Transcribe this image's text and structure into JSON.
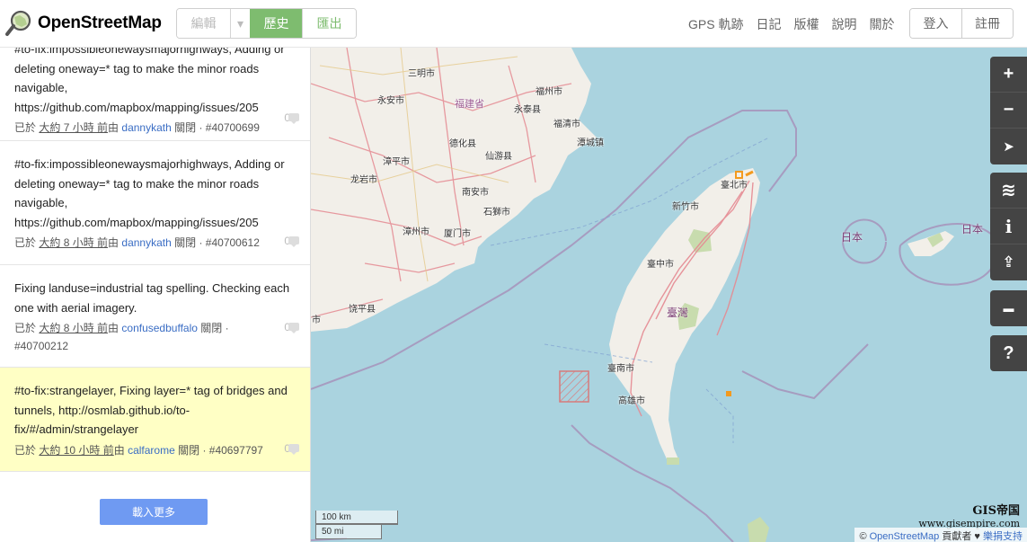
{
  "header": {
    "app_name": "OpenStreetMap",
    "edit_label": "編輯",
    "edit_caret": "▾",
    "history_label": "歷史",
    "export_label": "匯出",
    "nav": [
      "GPS 軌跡",
      "日記",
      "版權",
      "說明",
      "關於"
    ],
    "login_label": "登入",
    "signup_label": "註冊"
  },
  "sidebar": {
    "changesets": [
      {
        "comment": "#to-fix:impossibleonewaysmajorhighways, Adding or deleting oneway=* tag to make the minor roads navigable, https://github.com/mapbox/mapping/issues/205",
        "prefix": "已於",
        "time": "大約 7 小時 前",
        "by": "由",
        "user": "dannykath",
        "status": "關閉 · #40700699",
        "comments": "0"
      },
      {
        "comment": "#to-fix:impossibleonewaysmajorhighways, Adding or deleting oneway=* tag to make the minor roads navigable, https://github.com/mapbox/mapping/issues/205",
        "prefix": "已於",
        "time": "大約 8 小時 前",
        "by": "由",
        "user": "dannykath",
        "status": "關閉 · #40700612",
        "comments": "0"
      },
      {
        "comment": "Fixing landuse=industrial tag spelling. Checking each one with aerial imagery.",
        "prefix": "已於",
        "time": "大約 8 小時 前",
        "by": "由",
        "user": "confusedbuffalo",
        "status": "關閉 · #40700212",
        "comments": "0"
      },
      {
        "comment": "#to-fix:strangelayer, Fixing layer=* tag of bridges and tunnels, http://osmlab.github.io/to-fix/#/admin/strangelayer",
        "prefix": "已於",
        "time": "大約 10 小時 前",
        "by": "由",
        "user": "calfarome",
        "status": "關閉 · #40697797",
        "comments": "0"
      }
    ],
    "load_more_label": "載入更多"
  },
  "map": {
    "labels": {
      "sanming": "三明市",
      "fujian": "福建省",
      "fuzhou": "福州市",
      "yongan": "永安市",
      "yongtai": "永泰县",
      "fuqing": "福清市",
      "dehua": "德化县",
      "tantou": "潭城镇",
      "zhangping": "漳平市",
      "xianyou": "仙游县",
      "longyan": "龙岩市",
      "nanan": "南安市",
      "shishi": "石獅市",
      "zhangzhou": "漳州市",
      "xiamen": "厦门市",
      "raoping": "饶平县",
      "shi_edge": "市",
      "taipei": "臺北市",
      "xinzhu": "新竹市",
      "taizhong": "臺中市",
      "taiwan": "臺灣",
      "tainan": "臺南市",
      "gaoxiong": "高雄市",
      "japan1": "日本",
      "japan2": "日本"
    },
    "controls": {
      "zoom_in": "+",
      "zoom_out": "−",
      "locate": "➤",
      "layers": "≋",
      "info": "i",
      "share": "⇪",
      "note": "▬",
      "help": "?"
    },
    "scale_km": "100 km",
    "scale_mi": "50 mi",
    "attribution_prefix": "©",
    "attribution_link": "OpenStreetMap",
    "attribution_rest": "貢獻者 ♥",
    "attribution_donate": "樂捐支持",
    "watermark_line1": "GIS帝国",
    "watermark_line2": "www.gisempire.com"
  }
}
